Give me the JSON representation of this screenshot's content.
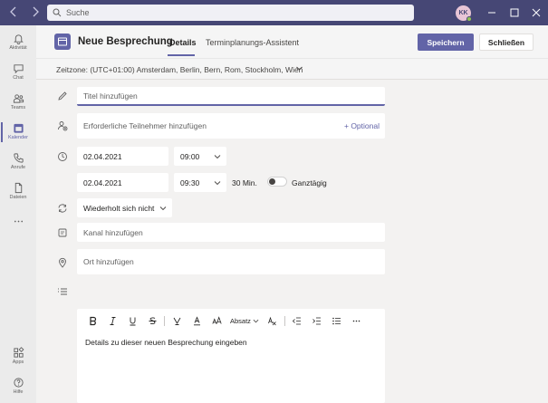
{
  "titlebar": {
    "search_placeholder": "Suche",
    "avatar_initials": "KK",
    "back_icon": "chevron-left-icon",
    "forward_icon": "chevron-right-icon"
  },
  "rail": {
    "items": [
      {
        "label": "Aktivität",
        "icon": "bell-icon"
      },
      {
        "label": "Chat",
        "icon": "chat-icon"
      },
      {
        "label": "Teams",
        "icon": "teams-icon"
      },
      {
        "label": "Kalender",
        "icon": "calendar-icon",
        "active": true
      },
      {
        "label": "Anrufe",
        "icon": "phone-icon"
      },
      {
        "label": "Dateien",
        "icon": "file-icon"
      },
      {
        "label": "Apps",
        "icon": "apps-icon"
      },
      {
        "label": "Hilfe",
        "icon": "help-icon"
      }
    ]
  },
  "header": {
    "title": "Neue Besprechung",
    "tabs": [
      {
        "label": "Details"
      },
      {
        "label": "Terminplanungs-Assistent"
      }
    ],
    "save_label": "Speichern",
    "close_label": "Schließen"
  },
  "timezone": "Zeitzone: (UTC+01:00) Amsterdam, Berlin, Bern, Rom, Stockholm, Wien",
  "form": {
    "title_placeholder": "Titel hinzufügen",
    "attendees_placeholder": "Erforderliche Teilnehmer hinzufügen",
    "optional_label": "+ Optional",
    "start_date": "02.04.2021",
    "start_time": "09:00",
    "end_date": "02.04.2021",
    "end_time": "09:30",
    "duration": "30 Min.",
    "all_day_label": "Ganztägig",
    "all_day": false,
    "repeat": "Wiederholt sich nicht",
    "channel_placeholder": "Kanal hinzufügen",
    "location_placeholder": "Ort hinzufügen"
  },
  "editor": {
    "paragraph_label": "Absatz",
    "body_placeholder": "Details zu dieser neuen Besprechung eingeben"
  },
  "colors": {
    "accent": "#6264a7",
    "titlebar": "#464775"
  }
}
